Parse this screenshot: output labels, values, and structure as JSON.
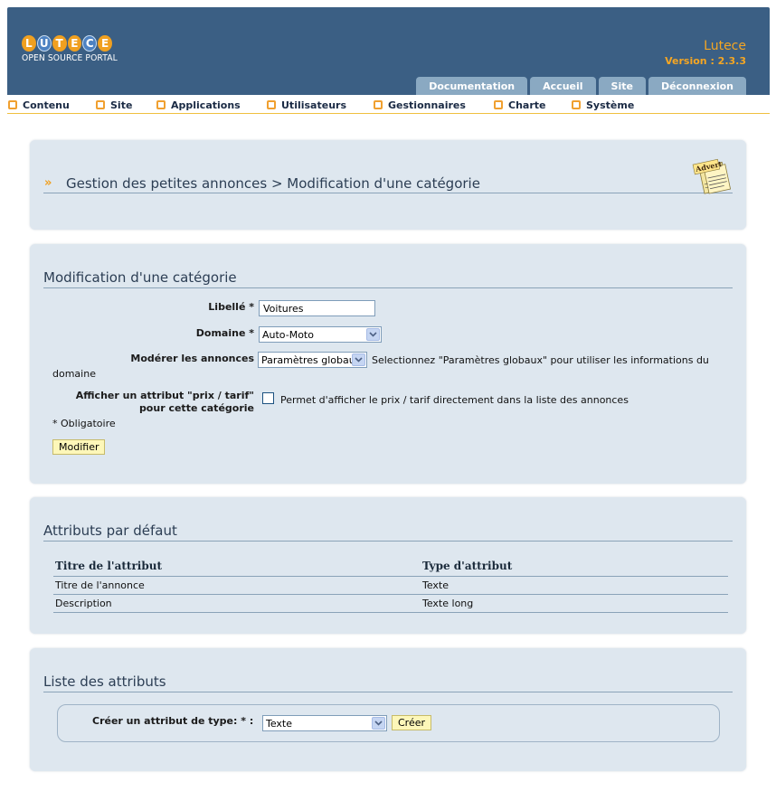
{
  "header": {
    "logo_letters": [
      "L",
      "U",
      "T",
      "E",
      "C",
      "E"
    ],
    "logo_tagline": "OPEN SOURCE PORTAL",
    "site_name": "Lutece",
    "version": "Version : 2.3.3",
    "tabs": [
      "Documentation",
      "Accueil",
      "Site",
      "Déconnexion"
    ]
  },
  "menu": [
    "Contenu",
    "Site",
    "Applications",
    "Utilisateurs",
    "Gestionnaires",
    "Charte",
    "Système"
  ],
  "breadcrumb": {
    "text": "Gestion des petites annonces > Modification d'une catégorie",
    "icon_text": "Advert"
  },
  "category_form": {
    "title": "Modification d'une catégorie",
    "label_field": {
      "label": "Libellé *",
      "value": "Voitures"
    },
    "domain_field": {
      "label": "Domaine *",
      "value": "Auto-Moto"
    },
    "moderate_field": {
      "label": "Modérer les annonces",
      "value": "Paramètres globaux",
      "help_line1": "Selectionnez \"Paramètres globaux\" pour utiliser les informations du",
      "help_line2": "domaine"
    },
    "price_field": {
      "label_line1": "Afficher un attribut \"prix / tarif\"",
      "label_line2": "pour cette catégorie",
      "help": "Permet d'afficher le prix / tarif directement dans la liste des annonces",
      "checked": false
    },
    "required_note": "* Obligatoire",
    "submit_label": "Modifier"
  },
  "default_attributes": {
    "title": "Attributs par défaut",
    "columns": [
      "Titre de l'attribut",
      "Type d'attribut"
    ],
    "rows": [
      {
        "name": "Titre de l'annonce",
        "type": "Texte"
      },
      {
        "name": "Description",
        "type": "Texte long"
      }
    ]
  },
  "attribute_list": {
    "title": "Liste des attributs",
    "create_label": "Créer un attribut de type: * :",
    "type_value": "Texte",
    "create_button": "Créer"
  },
  "colors": {
    "header_bg": "#3b5f84",
    "accent_orange": "#f5a623",
    "panel_bg": "#dee7ef",
    "tab_bg": "#8aa9c2",
    "button_bg": "#fdf7b9"
  }
}
